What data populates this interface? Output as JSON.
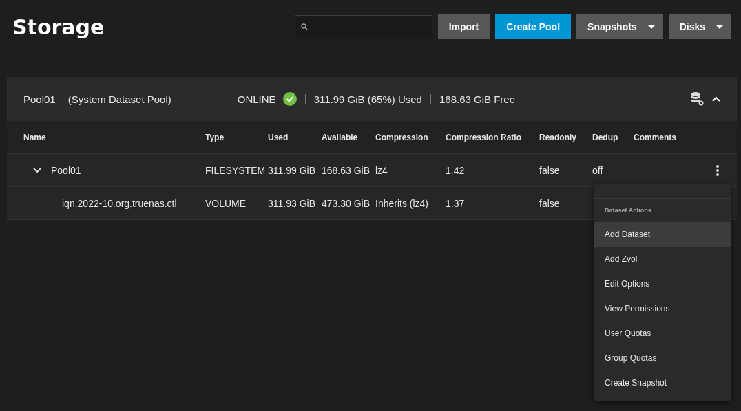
{
  "page": {
    "title": "Storage"
  },
  "toolbar": {
    "buttons": [
      {
        "label": "Import",
        "kind": "plain"
      },
      {
        "label": "Create Pool",
        "kind": "primary"
      },
      {
        "label": "Snapshots",
        "kind": "dropdown"
      },
      {
        "label": "Disks",
        "kind": "dropdown"
      }
    ]
  },
  "pool": {
    "name": "Pool01",
    "note": "(System Dataset Pool)",
    "status": "ONLINE",
    "used": "311.99 GiB (65%) Used",
    "free": "168.63 GiB Free",
    "expanded": true,
    "table": {
      "columns": [
        "Name",
        "Type",
        "Used",
        "Available",
        "Compression",
        "Compression Ratio",
        "Readonly",
        "Dedup",
        "Comments"
      ],
      "rows": [
        {
          "expanded": true,
          "cells": [
            "Pool01",
            "FILESYSTEM",
            "311.99 GiB",
            "168.63 GiB",
            "lz4",
            "1.42",
            "false",
            "off",
            ""
          ],
          "children": [
            {
              "cells": [
                "iqn.2022-10.org.truenas.ctl",
                "VOLUME",
                "311.93 GiB",
                "473.30 GiB",
                "Inherits (lz4)",
                "1.37",
                "false",
                "",
                ""
              ]
            }
          ]
        }
      ]
    }
  },
  "menu": {
    "heading": "Dataset Actions",
    "items": [
      {
        "label": "Add Dataset",
        "selected": true
      },
      {
        "label": "Add Zvol",
        "selected": false
      },
      {
        "label": "Edit Options",
        "selected": false
      },
      {
        "label": "View Permissions",
        "selected": false
      },
      {
        "label": "User Quotas",
        "selected": false
      },
      {
        "label": "Group Quotas",
        "selected": false
      },
      {
        "label": "Create Snapshot",
        "selected": false
      }
    ]
  }
}
